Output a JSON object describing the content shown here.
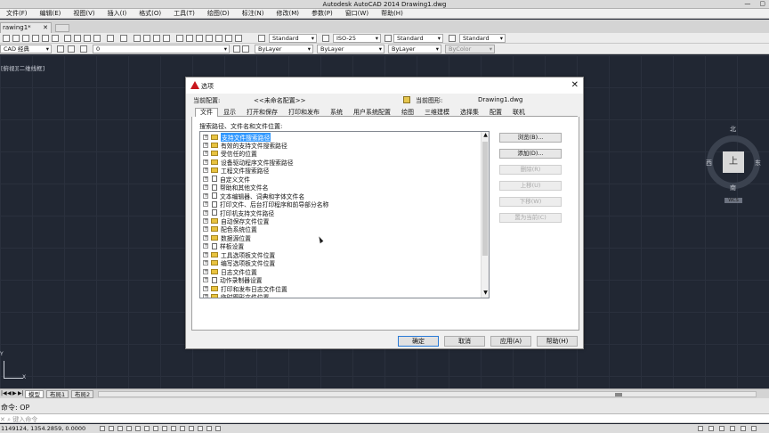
{
  "window": {
    "title": "Autodesk AutoCAD 2014    Drawing1.dwg",
    "minimize": "—",
    "restore": "▢",
    "close": "✕"
  },
  "menu": [
    "文件(F)",
    "编辑(E)",
    "视图(V)",
    "插入(I)",
    "格式(O)",
    "工具(T)",
    "绘图(D)",
    "标注(N)",
    "修改(M)",
    "参数(P)",
    "窗口(W)",
    "帮助(H)"
  ],
  "doc_tab": {
    "label": "rawing1*",
    "close": "✕"
  },
  "toolbar1": {
    "text_style": "Standard",
    "dim_style": "ISO-25",
    "table_style": "Standard",
    "multileader_style": "Standard"
  },
  "toolbar2": {
    "workspace": "CAD 经典",
    "layer": "0",
    "color": "ByLayer",
    "linetype": "ByLayer",
    "lineweight": "ByLayer",
    "plotstyle": "ByColor"
  },
  "viewport": {
    "label": "[俯视][二维线框]",
    "ucs_y": "Y",
    "ucs_x": "X"
  },
  "viewcube": {
    "north": "北",
    "south": "南",
    "east": "东",
    "west": "西",
    "top": "上",
    "wcs": "WCS"
  },
  "layout_tabs": {
    "nav": [
      "|◀",
      "◀",
      "▶",
      "▶|"
    ],
    "tabs": [
      "模型",
      "布局1",
      "布局2"
    ]
  },
  "command": {
    "history": "命令: OP",
    "prompt": "✕ ⌕ 键入命令"
  },
  "status": {
    "coords": "1149124, 1354.2859, 0.0000"
  },
  "dialog": {
    "title": "选项",
    "close": "✕",
    "profile_label": "当前配置:",
    "profile_value": "<<未命名配置>>",
    "drawing_label": "当前图形:",
    "drawing_value": "Drawing1.dwg",
    "tabs": [
      "文件",
      "显示",
      "打开和保存",
      "打印和发布",
      "系统",
      "用户系统配置",
      "绘图",
      "三维建模",
      "选择集",
      "配置",
      "联机"
    ],
    "tree_caption": "搜索路径、文件名和文件位置:",
    "tree_items": [
      {
        "label": "支持文件搜索路径",
        "icon": "folder",
        "selected": true
      },
      {
        "label": "有效的支持文件搜索路径",
        "icon": "folder"
      },
      {
        "label": "受信任的位置",
        "icon": "folder"
      },
      {
        "label": "设备驱动程序文件搜索路径",
        "icon": "folder"
      },
      {
        "label": "工程文件搜索路径",
        "icon": "folder"
      },
      {
        "label": "自定义文件",
        "icon": "document"
      },
      {
        "label": "帮助和其他文件名",
        "icon": "document"
      },
      {
        "label": "文本编辑器、词典和字体文件名",
        "icon": "document"
      },
      {
        "label": "打印文件、后台打印程序和前导部分名称",
        "icon": "document"
      },
      {
        "label": "打印机支持文件路径",
        "icon": "document"
      },
      {
        "label": "自动保存文件位置",
        "icon": "folder"
      },
      {
        "label": "配色系统位置",
        "icon": "folder"
      },
      {
        "label": "数据源位置",
        "icon": "folder"
      },
      {
        "label": "样板设置",
        "icon": "document"
      },
      {
        "label": "工具选项板文件位置",
        "icon": "folder"
      },
      {
        "label": "编写选项板文件位置",
        "icon": "folder"
      },
      {
        "label": "日志文件位置",
        "icon": "folder"
      },
      {
        "label": "动作录制器设置",
        "icon": "document"
      },
      {
        "label": "打印和发布日志文件位置",
        "icon": "folder"
      },
      {
        "label": "临时图形文件位置",
        "icon": "folder"
      }
    ],
    "side_buttons": [
      {
        "label": "浏览(B)...",
        "enabled": true
      },
      {
        "label": "添加(D)...",
        "enabled": true
      },
      {
        "label": "删除(R)",
        "enabled": false
      },
      {
        "label": "上移(U)",
        "enabled": false
      },
      {
        "label": "下移(W)",
        "enabled": false
      },
      {
        "label": "置为当前(C)",
        "enabled": false
      }
    ],
    "ok": "确定",
    "cancel": "取消",
    "apply": "应用(A)",
    "help": "帮助(H)"
  }
}
